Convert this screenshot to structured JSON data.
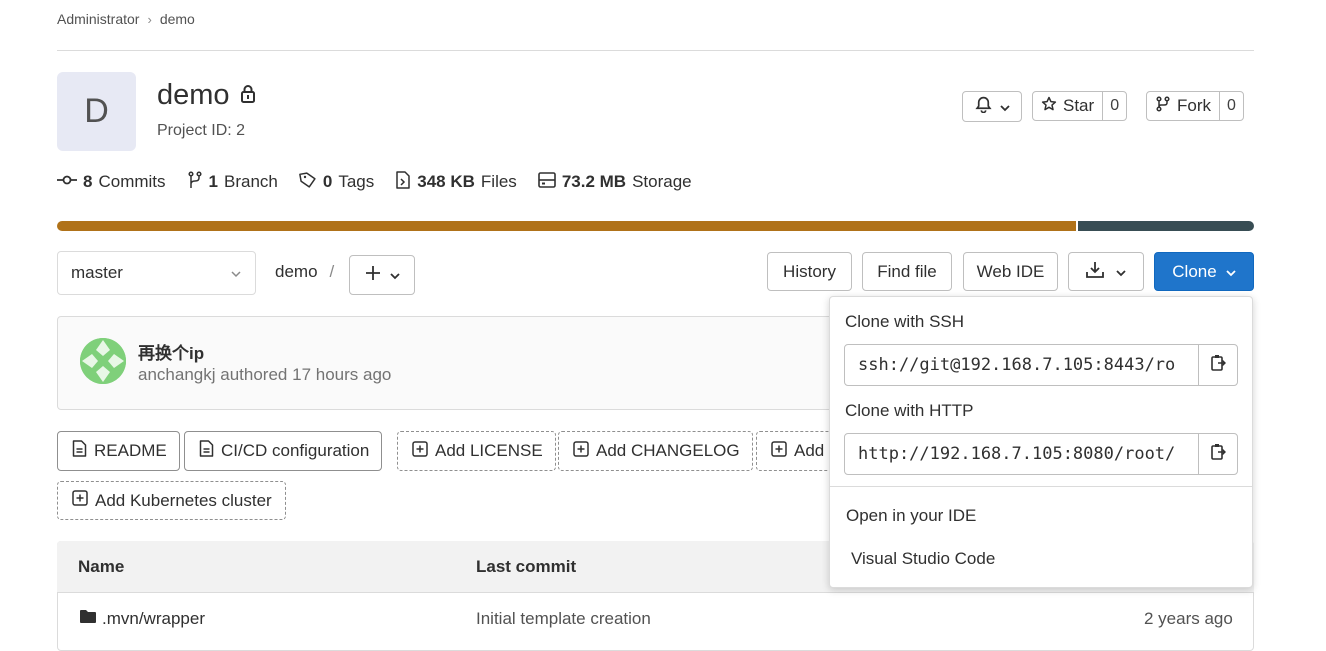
{
  "breadcrumb": {
    "parent": "Administrator",
    "separator": "›",
    "current": "demo"
  },
  "project": {
    "avatar_letter": "D",
    "name": "demo",
    "id_text": "Project ID: 2"
  },
  "actions": {
    "star_label": "Star",
    "star_count": "0",
    "fork_label": "Fork",
    "fork_count": "0"
  },
  "stats": [
    {
      "icon": "commit-icon",
      "value": "8",
      "label": "Commits"
    },
    {
      "icon": "branch-icon",
      "value": "1",
      "label": "Branch"
    },
    {
      "icon": "tag-icon",
      "value": "0",
      "label": "Tags"
    },
    {
      "icon": "file-icon",
      "value": "348 KB",
      "label": "Files"
    },
    {
      "icon": "storage-icon",
      "value": "73.2 MB",
      "label": "Storage"
    }
  ],
  "languages": [
    {
      "color": "#b07219",
      "fraction": 0.853
    },
    {
      "color": "#384d54",
      "fraction": 0.147
    }
  ],
  "repo_nav": {
    "branch": "master",
    "path_root": "demo",
    "path_sep": "/"
  },
  "toolbar": {
    "history": "History",
    "find_file": "Find file",
    "web_ide": "Web IDE",
    "clone": "Clone"
  },
  "commit": {
    "title": "再换个ip",
    "author": "anchangkj",
    "verb": "authored",
    "time": "17 hours ago"
  },
  "quick_actions": {
    "readme": "README",
    "cicd": "CI/CD configuration",
    "add_license": "Add LICENSE",
    "add_changelog": "Add CHANGELOG",
    "add_partial": "Add",
    "add_k8s": "Add Kubernetes cluster"
  },
  "table": {
    "headers": {
      "name": "Name",
      "last_commit": "Last commit"
    },
    "rows": [
      {
        "name": ".mvn/wrapper",
        "commit": "Initial template creation",
        "time": "2 years ago"
      }
    ]
  },
  "clone_dropdown": {
    "ssh_label": "Clone with SSH",
    "ssh_url": "ssh://git@192.168.7.105:8443/ro",
    "http_label": "Clone with HTTP",
    "http_url": "http://192.168.7.105:8080/root/",
    "ide_header": "Open in your IDE",
    "ide_option": "Visual Studio Code"
  },
  "colors": {
    "clone_button": "#1f75cb",
    "lang_primary": "#b07219",
    "lang_secondary": "#384d54"
  }
}
